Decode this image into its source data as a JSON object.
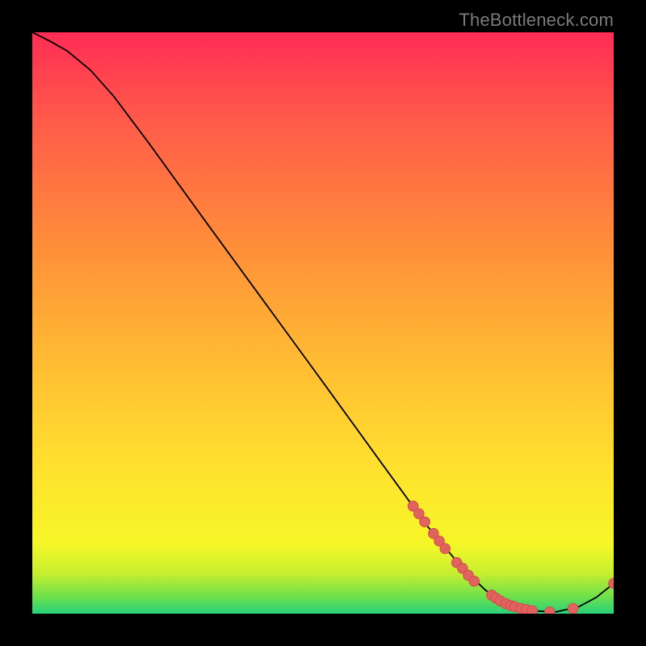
{
  "watermark": "TheBottleneck.com",
  "chart_data": {
    "type": "line",
    "title": "",
    "xlabel": "",
    "ylabel": "",
    "xlim": [
      0,
      100
    ],
    "ylim": [
      0,
      100
    ],
    "gradient_stops": [
      {
        "offset": 0,
        "color": "#28d17c"
      },
      {
        "offset": 3,
        "color": "#6fe04a"
      },
      {
        "offset": 7,
        "color": "#c7ef2f"
      },
      {
        "offset": 12,
        "color": "#f6f728"
      },
      {
        "offset": 25,
        "color": "#ffe12e"
      },
      {
        "offset": 45,
        "color": "#ffb833"
      },
      {
        "offset": 65,
        "color": "#ff8a3a"
      },
      {
        "offset": 85,
        "color": "#ff5a4a"
      },
      {
        "offset": 100,
        "color": "#ff2c55"
      }
    ],
    "curve": [
      {
        "x": 0.0,
        "y": 100.0
      },
      {
        "x": 3.0,
        "y": 98.5
      },
      {
        "x": 6.0,
        "y": 96.8
      },
      {
        "x": 10.0,
        "y": 93.5
      },
      {
        "x": 14.0,
        "y": 89.0
      },
      {
        "x": 20.0,
        "y": 81.0
      },
      {
        "x": 30.0,
        "y": 67.2
      },
      {
        "x": 40.0,
        "y": 53.5
      },
      {
        "x": 50.0,
        "y": 39.8
      },
      {
        "x": 60.0,
        "y": 26.0
      },
      {
        "x": 68.0,
        "y": 15.0
      },
      {
        "x": 74.0,
        "y": 7.8
      },
      {
        "x": 78.0,
        "y": 4.0
      },
      {
        "x": 82.0,
        "y": 1.6
      },
      {
        "x": 86.0,
        "y": 0.5
      },
      {
        "x": 90.0,
        "y": 0.3
      },
      {
        "x": 94.0,
        "y": 1.2
      },
      {
        "x": 97.0,
        "y": 2.8
      },
      {
        "x": 100.0,
        "y": 5.2
      }
    ],
    "markers": [
      {
        "x": 65.5,
        "y": 18.5
      },
      {
        "x": 66.5,
        "y": 17.2
      },
      {
        "x": 67.5,
        "y": 15.8
      },
      {
        "x": 69.0,
        "y": 13.8
      },
      {
        "x": 70.0,
        "y": 12.5
      },
      {
        "x": 71.0,
        "y": 11.2
      },
      {
        "x": 73.0,
        "y": 8.8
      },
      {
        "x": 74.0,
        "y": 7.8
      },
      {
        "x": 75.0,
        "y": 6.6
      },
      {
        "x": 76.0,
        "y": 5.6
      },
      {
        "x": 79.0,
        "y": 3.2
      },
      {
        "x": 79.7,
        "y": 2.7
      },
      {
        "x": 80.5,
        "y": 2.2
      },
      {
        "x": 81.5,
        "y": 1.7
      },
      {
        "x": 82.3,
        "y": 1.4
      },
      {
        "x": 83.0,
        "y": 1.2
      },
      {
        "x": 84.0,
        "y": 0.9
      },
      {
        "x": 85.0,
        "y": 0.7
      },
      {
        "x": 86.0,
        "y": 0.5
      },
      {
        "x": 89.0,
        "y": 0.3
      },
      {
        "x": 93.0,
        "y": 0.9
      },
      {
        "x": 100.0,
        "y": 5.2
      }
    ],
    "marker_style": {
      "r": 6.3,
      "fill": "#e0635f",
      "stroke": "#d24d49"
    }
  }
}
